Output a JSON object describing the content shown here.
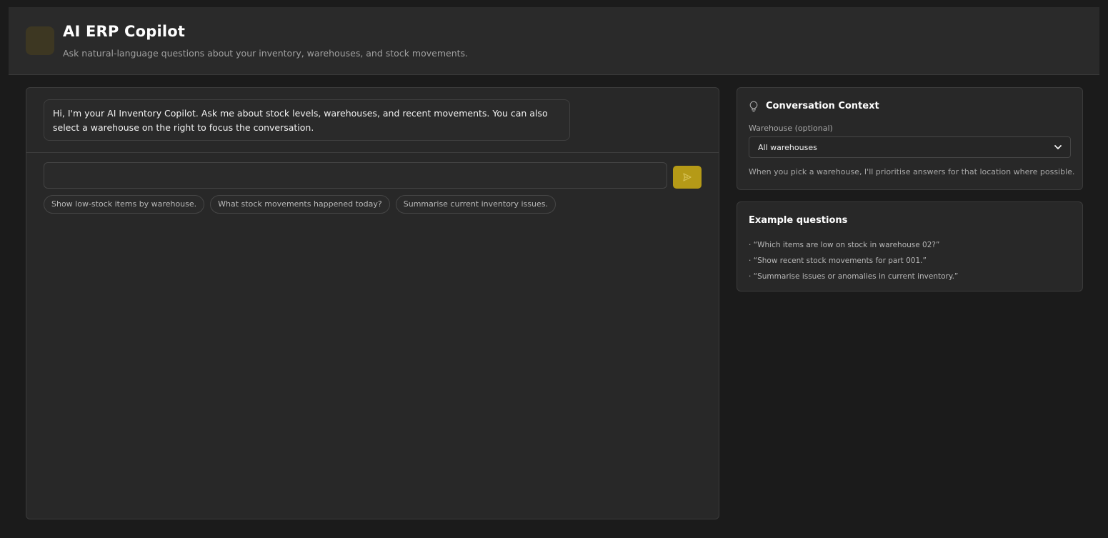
{
  "header": {
    "title": "AI ERP Copilot",
    "subtitle": "Ask natural-language questions about your inventory, warehouses, and stock movements.",
    "logo_icon": "logo-icon"
  },
  "chat": {
    "welcome_message": "Hi, I'm your AI Inventory Copilot. Ask me about stock levels, warehouses, and recent movements. You can also select a warehouse on the right to focus the conversation.",
    "input_value": "",
    "send_icon": "send-icon",
    "suggestions": [
      "Show low-stock items by warehouse.",
      "What stock movements happened today?",
      "Summarise current inventory issues."
    ]
  },
  "context": {
    "title": "Conversation Context",
    "icon": "lightbulb-icon",
    "warehouse_label": "Warehouse (optional)",
    "warehouse_selected": "All warehouses",
    "hint": "When you pick a warehouse, I'll prioritise answers for that location where possible."
  },
  "examples": {
    "title": "Example questions",
    "items": [
      "· “Which items are low on stock in warehouse 02?”",
      "· “Show recent stock movements for part 001.”",
      "· “Summarise issues or anomalies in current inventory.”"
    ]
  },
  "colors": {
    "accent": "#b59a17",
    "background": "#1b1b1b",
    "panel": "#282828"
  }
}
